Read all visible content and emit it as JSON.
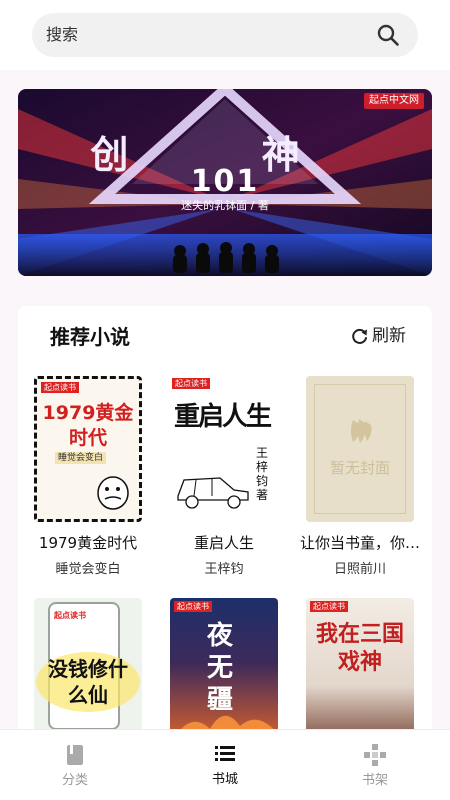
{
  "search": {
    "placeholder": "搜索",
    "icon": "search-icon"
  },
  "banner": {
    "title_main": "创 神",
    "title_number": "101",
    "author_line": "迷失的乳钵面 / 著",
    "publisher": "起点中文网",
    "colors": {
      "accent": "#e8d9ff",
      "glow": "#ff3b3b"
    }
  },
  "section": {
    "title": "推荐小说",
    "refresh_label": "刷新",
    "refresh_icon": "refresh-icon"
  },
  "books": [
    {
      "title": "1979黄金时代",
      "author": "睡觉会变白",
      "cover_text": "1979黄金时代",
      "cover_sub": "睡觉会变白",
      "cover_badge": "起点读书"
    },
    {
      "title": "重启人生",
      "author": "王梓钧",
      "cover_text": "重启人生",
      "cover_sub": "王梓钧 著",
      "cover_badge": "起点读书"
    },
    {
      "title": "让你当书童，你…",
      "author": "日照前川",
      "cover_text": "暂无封面"
    },
    {
      "title": "",
      "author": "",
      "cover_text": "没钱修什么仙",
      "cover_badge": "起点读书"
    },
    {
      "title": "",
      "author": "",
      "cover_text": "夜无疆",
      "cover_badge": "起点读书"
    },
    {
      "title": "",
      "author": "",
      "cover_text": "我在三国戏神",
      "cover_badge": "起点读书"
    }
  ],
  "tabs": [
    {
      "label": "分类",
      "icon": "book-icon",
      "active": false
    },
    {
      "label": "书城",
      "icon": "list-icon",
      "active": true
    },
    {
      "label": "书架",
      "icon": "shelf-icon",
      "active": false
    }
  ],
  "colors": {
    "active_tab": "#111111",
    "inactive_tab": "#999999"
  }
}
